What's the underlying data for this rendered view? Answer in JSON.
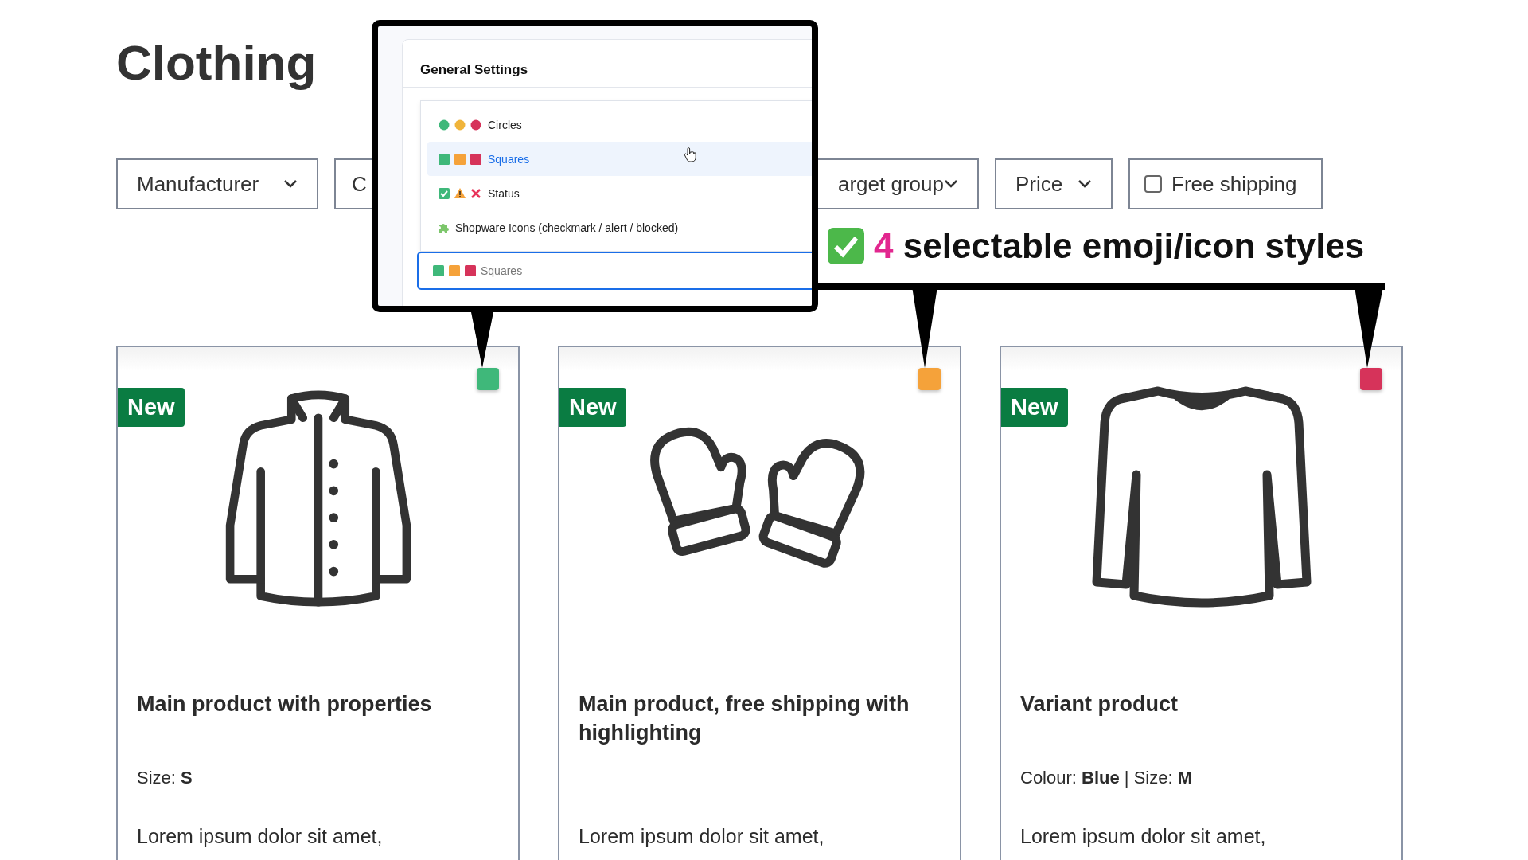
{
  "page_title": "Clothing",
  "filters": [
    {
      "kind": "dropdown",
      "label": "Manufacturer"
    },
    {
      "kind": "dropdown",
      "label": "C"
    },
    {
      "kind": "dropdown",
      "label": "arget group"
    },
    {
      "kind": "dropdown",
      "label": "Price"
    },
    {
      "kind": "checkbox",
      "label": "Free shipping",
      "checked": false
    }
  ],
  "settings_popup": {
    "title": "General Settings",
    "options": [
      {
        "kind": "circles",
        "label": "Circles",
        "selected": false
      },
      {
        "kind": "squares",
        "label": "Squares",
        "selected": true
      },
      {
        "kind": "status",
        "label": "Status",
        "selected": false
      },
      {
        "kind": "shopware",
        "label": "Shopware Icons (checkmark / alert / blocked)",
        "selected": false
      }
    ],
    "field": {
      "kind": "squares",
      "value": "Squares"
    }
  },
  "callout": {
    "count": "4",
    "text": "selectable emoji/icon styles"
  },
  "products": [
    {
      "badge": "New",
      "color": "#3fb87a",
      "kind": "jacket",
      "name": "Main product with properties",
      "properties": "Size: **S**",
      "description": "Lorem ipsum dolor sit amet,"
    },
    {
      "badge": "New",
      "color": "#f5a23a",
      "kind": "mittens",
      "name": "Main product, free shipping with highlighting",
      "description": "Lorem ipsum dolor sit amet,"
    },
    {
      "badge": "New",
      "color": "#d6335a",
      "kind": "sweater",
      "name": "Variant product",
      "properties": "Colour: **Blue** | Size: **M**",
      "description": "Lorem ipsum dolor sit amet,"
    }
  ]
}
